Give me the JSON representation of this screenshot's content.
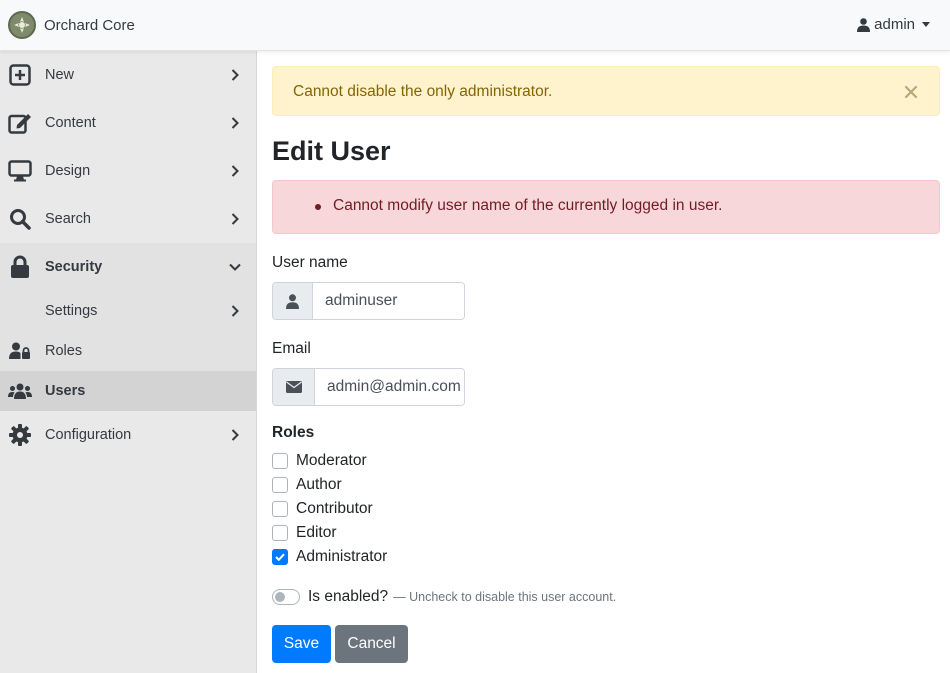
{
  "app": {
    "title": "Orchard Core"
  },
  "user_menu": {
    "label": "admin"
  },
  "sidebar": {
    "items": [
      {
        "label": "New",
        "icon": "plus-square-icon"
      },
      {
        "label": "Content",
        "icon": "edit-icon"
      },
      {
        "label": "Design",
        "icon": "desktop-icon"
      },
      {
        "label": "Search",
        "icon": "search-icon"
      },
      {
        "label": "Security",
        "icon": "lock-icon",
        "expanded": true
      },
      {
        "label": "Settings",
        "icon": ""
      },
      {
        "label": "Roles",
        "icon": "user-lock-icon"
      },
      {
        "label": "Users",
        "icon": "users-icon",
        "active": true
      },
      {
        "label": "Configuration",
        "icon": "cog-icon"
      }
    ]
  },
  "alerts": {
    "warning": "Cannot disable the only administrator.",
    "error": "Cannot modify user name of the currently logged in user."
  },
  "page": {
    "title": "Edit User"
  },
  "form": {
    "username": {
      "label": "User name",
      "value": "adminuser"
    },
    "email": {
      "label": "Email",
      "value": "admin@admin.com"
    },
    "roles_label": "Roles",
    "roles": [
      {
        "label": "Moderator",
        "checked": false
      },
      {
        "label": "Author",
        "checked": false
      },
      {
        "label": "Contributor",
        "checked": false
      },
      {
        "label": "Editor",
        "checked": false
      },
      {
        "label": "Administrator",
        "checked": true
      }
    ],
    "enabled": {
      "label": "Is enabled?",
      "hint": "— Uncheck to disable this user account.",
      "checked": false
    },
    "save_label": "Save",
    "cancel_label": "Cancel"
  },
  "colors": {
    "primary": "#007bff",
    "secondary": "#6c757d",
    "warning_bg": "#fff3cd",
    "danger_bg": "#f8d7da"
  }
}
